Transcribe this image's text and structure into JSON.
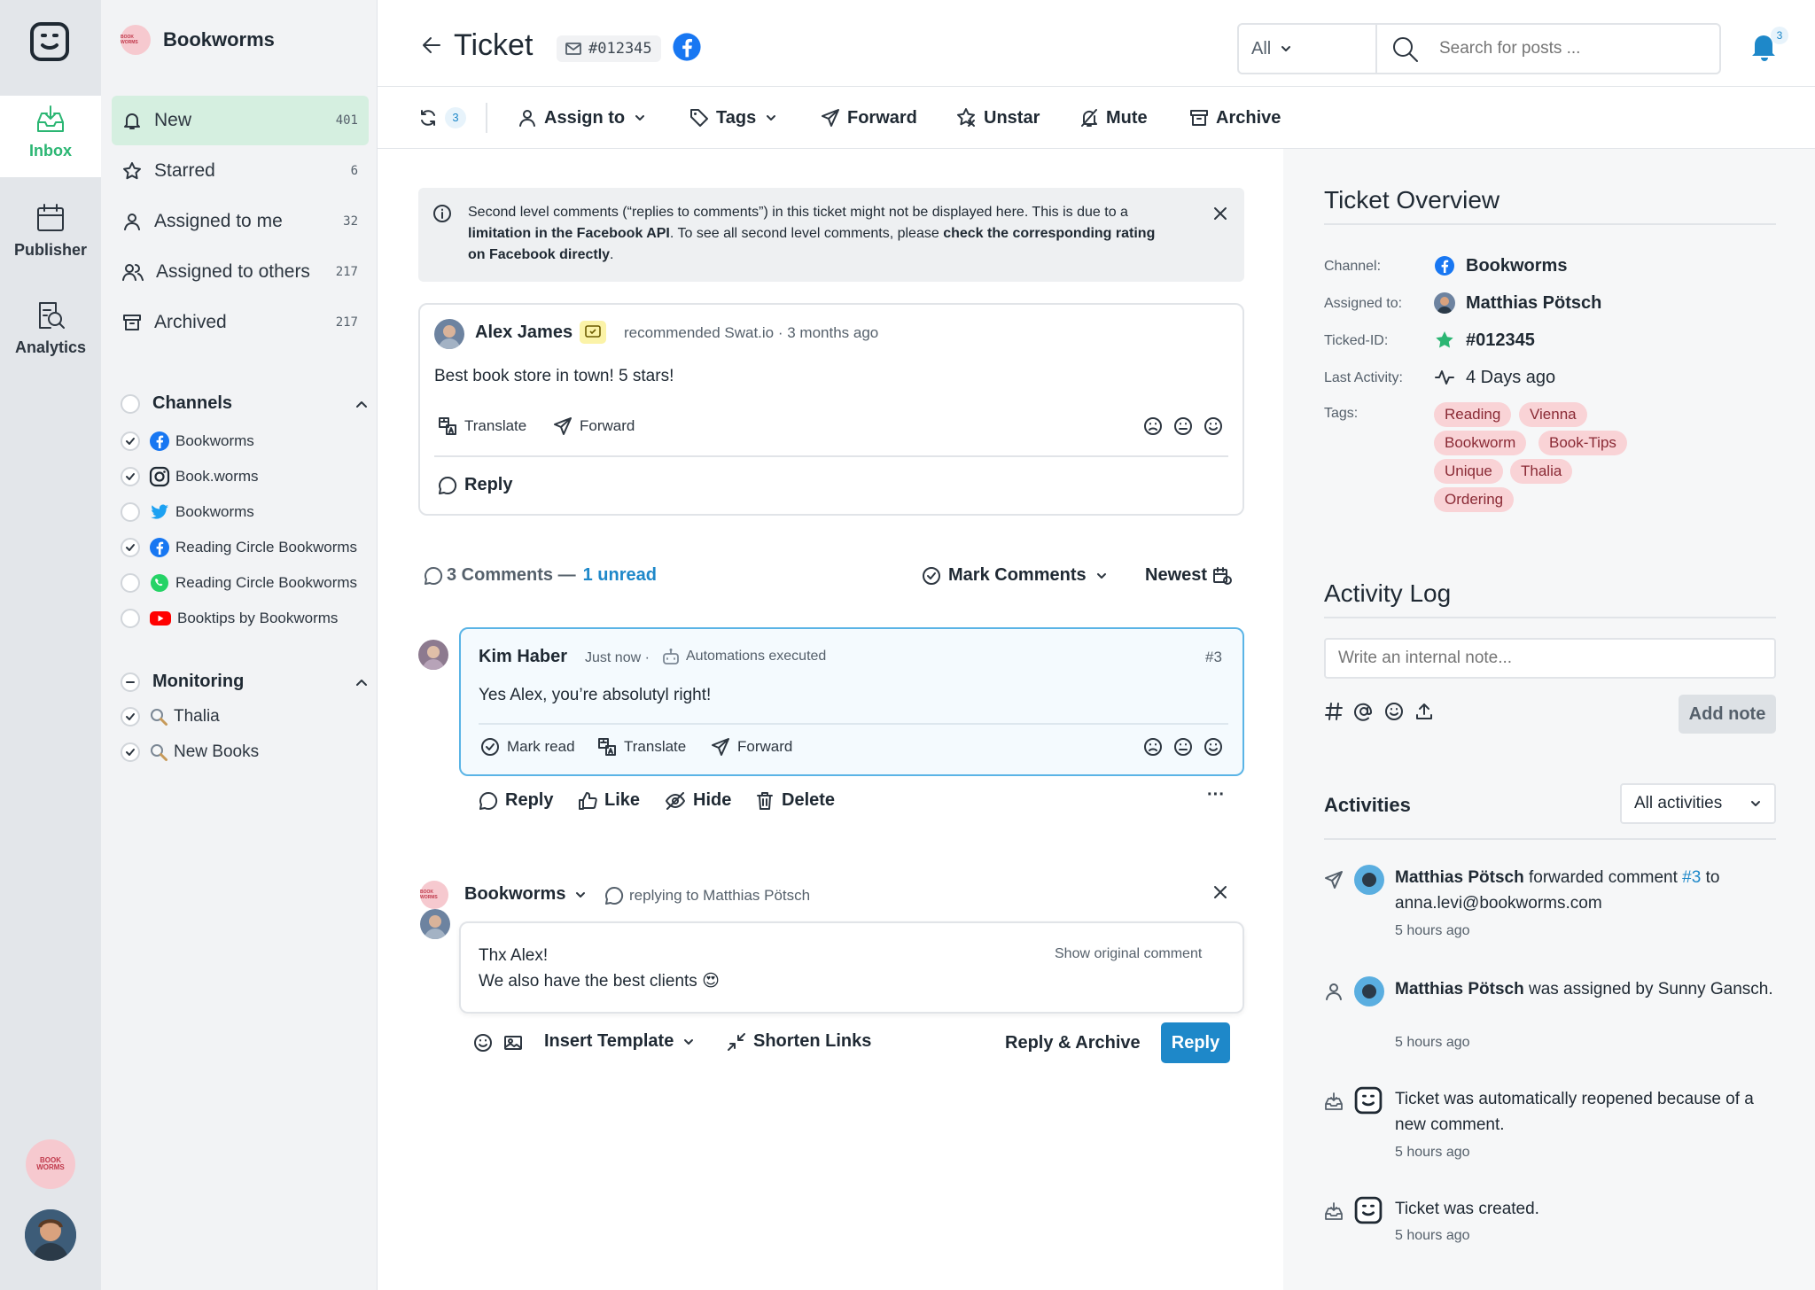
{
  "rail": {
    "items": [
      {
        "label": "Inbox",
        "icon": "inbox-icon",
        "active": true
      },
      {
        "label": "Publisher",
        "icon": "calendar-icon"
      },
      {
        "label": "Analytics",
        "icon": "analytics-icon"
      }
    ],
    "brand_avatar_text": "BOOK WORMS"
  },
  "sidebar": {
    "brand": "Bookworms",
    "brand_logo_text": "BOOK WORMS",
    "nav": [
      {
        "label": "New",
        "count": "401",
        "icon": "bell-icon",
        "active": true
      },
      {
        "label": "Starred",
        "count": "6",
        "icon": "star-icon"
      },
      {
        "label": "Assigned to me",
        "count": "32",
        "icon": "user-icon"
      },
      {
        "label": "Assigned to others",
        "count": "217",
        "icon": "users-icon"
      },
      {
        "label": "Archived",
        "count": "217",
        "icon": "archive-icon"
      }
    ],
    "channels_title": "Channels",
    "channels": [
      {
        "label": "Bookworms",
        "network": "facebook",
        "checked": true
      },
      {
        "label": "Book.worms",
        "network": "instagram",
        "checked": true
      },
      {
        "label": "Bookworms",
        "network": "twitter",
        "checked": false
      },
      {
        "label": "Reading Circle Bookworms",
        "network": "facebook",
        "checked": true
      },
      {
        "label": "Reading Circle Bookworms",
        "network": "whatsapp",
        "checked": false
      },
      {
        "label": "Booktips by Bookworms",
        "network": "youtube",
        "checked": false
      }
    ],
    "monitoring_title": "Monitoring",
    "monitoring": [
      {
        "label": "Thalia",
        "checked": true
      },
      {
        "label": "New Books",
        "checked": true
      }
    ]
  },
  "header": {
    "title": "Ticket",
    "ticket_id": "#012345",
    "filter_value": "All",
    "search_placeholder": "Search for posts ...",
    "notifications": "3"
  },
  "toolbar": {
    "refresh_count": "3",
    "assign": "Assign to",
    "tags": "Tags",
    "forward": "Forward",
    "unstar": "Unstar",
    "mute": "Mute",
    "archive": "Archive"
  },
  "notice": {
    "text_a": "Second level comments (“replies to comments”) in this ticket might not be displayed here. This is due to a ",
    "text_b": "limitation in the Facebook API",
    "text_c": ". To see all second level comments, please ",
    "text_d": "check the corresponding rating on Facebook directly",
    "text_e": "."
  },
  "post": {
    "author": "Alex James",
    "meta": "recommended Swat.io · 3 months ago",
    "body": "Best book store in town! 5 stars!",
    "translate": "Translate",
    "forward": "Forward",
    "reply": "Reply"
  },
  "comments_bar": {
    "count": "3 Comments —",
    "unread": "1 unread",
    "mark": "Mark Comments",
    "sort": "Newest"
  },
  "comment": {
    "author": "Kim Haber",
    "time": "Just now ·",
    "automation": "Automations executed",
    "number": "#3",
    "body": "Yes Alex, you’re absolutyl right!",
    "mark_read": "Mark read",
    "translate": "Translate",
    "forward": "Forward",
    "reply": "Reply",
    "like": "Like",
    "hide": "Hide",
    "delete": "Delete",
    "more": "···"
  },
  "composer": {
    "account": "Bookworms",
    "replying": "replying to Matthias Pötsch",
    "line1": "Thx Alex!",
    "line2": "We also have the best clients 😍",
    "show_original": "Show original comment",
    "insert_template": "Insert Template",
    "shorten": "Shorten Links",
    "reply_archive": "Reply & Archive",
    "reply": "Reply"
  },
  "overview": {
    "title": "Ticket Overview",
    "channel_label": "Channel:",
    "channel": "Bookworms",
    "assigned_label": "Assigned to:",
    "assigned": "Matthias Pötsch",
    "ticket_label": "Ticked-ID:",
    "ticket": "#012345",
    "activity_label": "Last Activity:",
    "activity": "4 Days ago",
    "tags_label": "Tags:",
    "tags": [
      "Reading",
      "Vienna",
      "Bookworm",
      "Book-Tips",
      "Unique",
      "Thalia",
      "Ordering"
    ]
  },
  "activity_log": {
    "title": "Activity Log",
    "note_placeholder": "Write an internal note...",
    "add_note": "Add note",
    "activities_title": "Activities",
    "filter": "All activities",
    "items": [
      {
        "actor": "Matthias Pötsch",
        "text": " forwarded comment ",
        "link": "#3",
        "rest": " to anna.levi@bookworms.com",
        "time": "5 hours ago"
      },
      {
        "actor": "Matthias Pötsch",
        "text": " was assigned by Sunny Gansch.",
        "link": "",
        "rest": "",
        "time": "5 hours ago"
      },
      {
        "actor": "",
        "text": "Ticket was automatically reopened because of a new comment.",
        "link": "",
        "rest": "",
        "time": "5 hours ago"
      },
      {
        "actor": "",
        "text": "Ticket was created.",
        "link": "",
        "rest": "",
        "time": "5 hours ago"
      }
    ]
  },
  "colors": {
    "accent_green": "#2bb673",
    "link_blue": "#1e88c9",
    "facebook": "#1877f2",
    "tag_bg": "#f9d3d6"
  }
}
